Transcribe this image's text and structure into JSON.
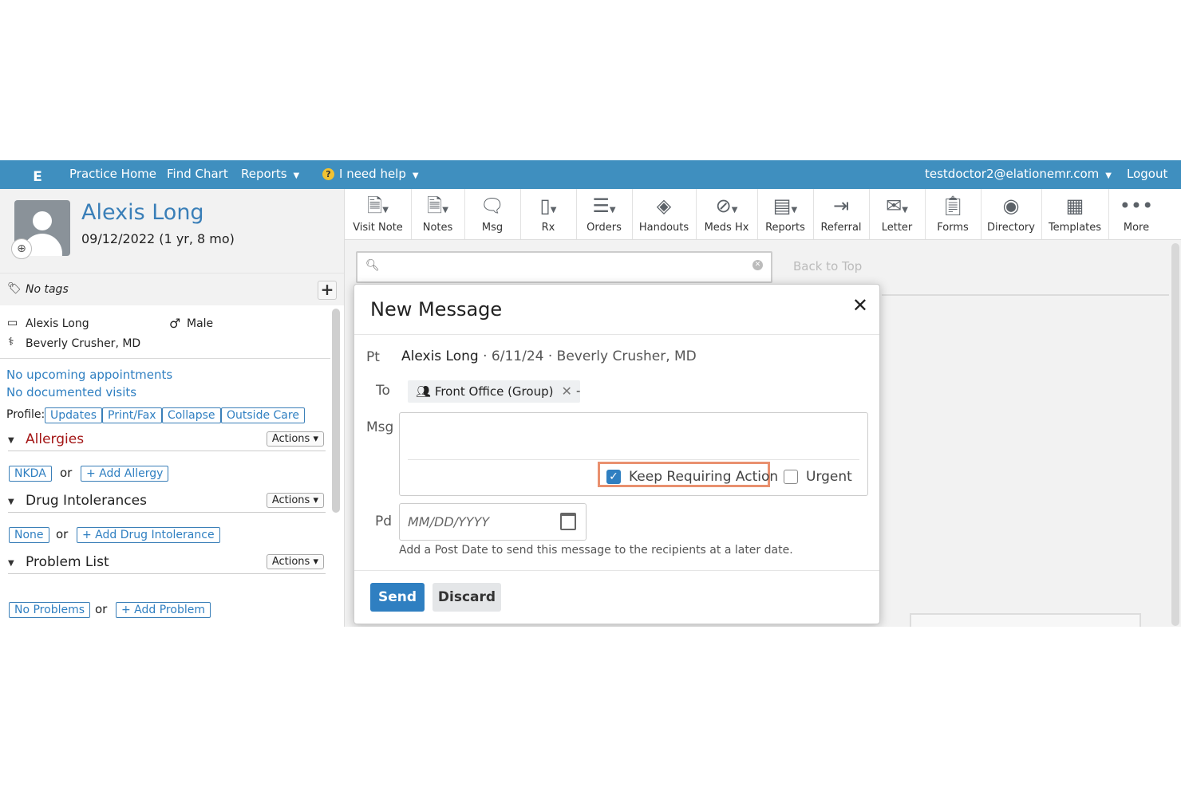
{
  "nav": {
    "logo": "E",
    "practice_home": "Practice Home",
    "find_chart": "Find Chart",
    "reports": "Reports",
    "help": "I need help",
    "user_email": "testdoctor2@elationemr.com",
    "logout": "Logout"
  },
  "patient": {
    "name": "Alexis Long",
    "dob": "09/12/2022 (1 yr, 8 mo)",
    "tags": "No tags",
    "display_name": "Alexis Long",
    "sex": "Male",
    "provider": "Beverly Crusher, MD",
    "appointments": "No upcoming appointments",
    "visits": "No documented visits"
  },
  "profile": {
    "label": "Profile:",
    "buttons": [
      "Updates",
      "Print/Fax",
      "Collapse",
      "Outside Care"
    ]
  },
  "sections": {
    "actions_label": "Actions",
    "or": "or",
    "allergies": {
      "title": "Allergies",
      "pill1": "NKDA",
      "pill2": "+ Add Allergy"
    },
    "drug": {
      "title": "Drug Intolerances",
      "pill1": "None",
      "pill2": "+ Add Drug Intolerance"
    },
    "problems": {
      "title": "Problem List",
      "pill1": "No Problems",
      "pill2": "+ Add Problem"
    }
  },
  "toolbar": [
    "Visit Note",
    "Notes",
    "Msg",
    "Rx",
    "Orders",
    "Handouts",
    "Meds Hx",
    "Reports",
    "Referral",
    "Letter",
    "Forms",
    "Directory",
    "Templates",
    "More"
  ],
  "main": {
    "back_to_top": "Back to Top"
  },
  "modal": {
    "title": "New Message",
    "pt_label": "Pt",
    "pt_name": "Alexis Long",
    "pt_meta": " · 6/11/24 · Beverly Crusher, MD",
    "to_label": "To",
    "recipient": "Front Office (Group)",
    "to_dash": "-",
    "msg_label": "Msg",
    "keep_requiring_action": "Keep Requiring Action",
    "keep_checked": true,
    "urgent": "Urgent",
    "urgent_checked": false,
    "pd_label": "Pd",
    "date_placeholder": "MM/DD/YYYY",
    "hint": "Add a Post Date to send this message to the recipients at a later date.",
    "send": "Send",
    "discard": "Discard"
  },
  "colors": {
    "nav_blue": "#3f8fbf",
    "link_blue": "#2f7fc1",
    "allergy_red": "#a31515",
    "highlight_orange": "#e9906f"
  }
}
